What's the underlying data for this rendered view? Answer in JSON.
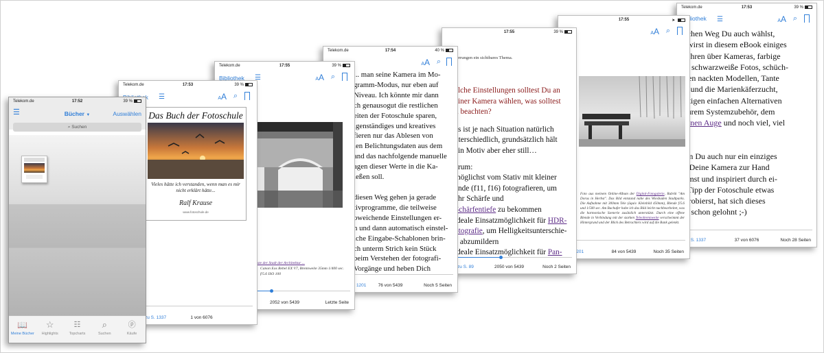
{
  "common": {
    "carrier": "Telekom.de",
    "library": "Bibliothek",
    "aa": "AA"
  },
  "phone1": {
    "carrier": "Telekom.de",
    "time": "17:52",
    "battery": "39 %",
    "title": "Bücher",
    "select": "Auswählen",
    "search_placeholder": "Suchen",
    "tabs": [
      "Meine Bücher",
      "Highlights",
      "Topcharts",
      "Suchen",
      "Käufe"
    ],
    "colors": {
      "accent": "#2f7ed8"
    }
  },
  "phone2": {
    "time": "17:53",
    "battery": "39 %",
    "cover_title": "Das Buch der Fotoschule",
    "cover_quote": "Vieles hätte ich verstanden, wenn man es mir nicht erklärt hätte...",
    "cover_author": "Ralf Krause",
    "cover_url": "www.fotoschule.de",
    "back": "zu S. 1337",
    "position": "1 von 6076"
  },
  "phone3": {
    "time": "17:55",
    "battery": "39 %",
    "caption_link": "Reste der Stadt der Architektur ...",
    "caption": "Canon Eos Rebel EX V7, Brennweite 35mm 1/400 sec. f/5.6 ISO 100",
    "position": "2052 von 5439",
    "remaining": "Letzte Seite"
  },
  "phone4": {
    "time": "17:54",
    "battery": "40 %",
    "lines": [
      "... man seine Kamera im Mo-",
      "gramm-Modus, nur eben auf",
      "Niveau. Ich könnte mir dann",
      "ch genausogut die restlichen",
      "eiten der Fotoschule sparen,",
      "igenständiges und kreatives",
      "fieren nur das Ablesen von",
      "len Belichtungsdaten aus dem",
      "and das nachfolgende manuelle",
      "agen dieser Werte in die Ka-",
      "ießen soll.",
      "",
      "diesen Weg gehen ja gerade",
      "tivprogramme, die teilweise",
      "oweichende Einstellungen er-",
      "n und dann automatisch einstel-",
      "lche Eingabe-Schablonen brin-",
      "ch unterm Strich kein Stück",
      "beim Verstehen der fotografi-",
      "Vorgänge und heben Dich"
    ],
    "back": "S. 1201",
    "position": "76 von 5439",
    "remaining": "Noch 5 Seiten"
  },
  "phone5": {
    "time": "17:55",
    "battery": "39 %",
    "top_line": "zerrungen ein sichtbares Thema.",
    "q1": "elche Einstellungen solltest Du an",
    "q2": "einer Kamera wählen, was solltest",
    "q3": "u beachten?",
    "p1": "as ist je nach Situation natürlich",
    "p2": "nterschiedlich, grundsätzlich hält",
    "p3": "ein Motiv aber eher still…",
    "p4": "arum:",
    "b1": "möglichst vom Stativ mit kleiner",
    "b2": "ende (f11, f16) fotografieren, um",
    "b3": "ehr Schärfe und",
    "b4_link": "Schärfentiefe",
    "b4": " zu bekommen",
    "b5": "ideale Einsatzmöglichkeit für ",
    "b5_link": "HDR-",
    "b6_link": "otografie",
    "b6": ", um Helligkeitsunterschie-",
    "b7": "e abzumildern",
    "b8": "ideale Einsatzmöglichkeit für ",
    "b8_link": "Pan-",
    "back": "zu S. 89",
    "position": "2050 von 5439",
    "remaining": "Noch 2 Seiten"
  },
  "phone6": {
    "time": "17:55",
    "battery": "",
    "caption_a": "Foto aus meinem Online-Album der ",
    "caption_link": "Digital-Fotogalerie",
    "caption_b": ", Rubrik \"Am Dorus in Herbst\". Das Bild entstand nahe des Wiesbaden Stadtparks. Die Aufnahme mit 300mm Tele (äquiv. Kleinbild 450mm), Blende f/5.6 und 1/500 sec. Am Bachufer habe ich das Bild leicht nachbearbeitet, was die harmonische Szenerie zusätzlich unterstützt. Durch eine offene Blende in Verbindung mit der starken ",
    "caption_link2": "Teleobrennweite",
    "caption_c": " verschwimmt der Hintergrund und der Blick des Betrachters wird auf die Bank gelenkt.",
    "back": "zu S. 1201",
    "position": "84 von 5439",
    "remaining": "Noch 35 Seiten"
  },
  "phone7": {
    "carrier": "Telekom.de",
    "time": "17:53",
    "battery": "39 %",
    "lines": [
      "elchen Weg Du auch wählst,",
      "u wirst in diesem eBook einiges",
      "rfahren über Kameras, farbige",
      "nd schwarzweiße Fotos, schüch-",
      "rnen nackten Modellen, Tante",
      "rti und die Marienkäferzucht,",
      "nstigen einfachen Alternativen",
      "teurem Systemzubehör, dem",
      "ffenen Auge",
      " und noch viel, viel",
      "hr.",
      "",
      "enn Du auch nur ein einziges",
      "al Deine Kamera zur Hand",
      "mmst und inspiriert durch ei-",
      "n Tipp der Fotoschule etwas",
      "sprobierst, hat sich dieses",
      "ch schon gelohnt ;-)"
    ],
    "back": "k zu S. 1337",
    "position": "37 von 6076",
    "remaining": "Noch 28 Seiten"
  }
}
